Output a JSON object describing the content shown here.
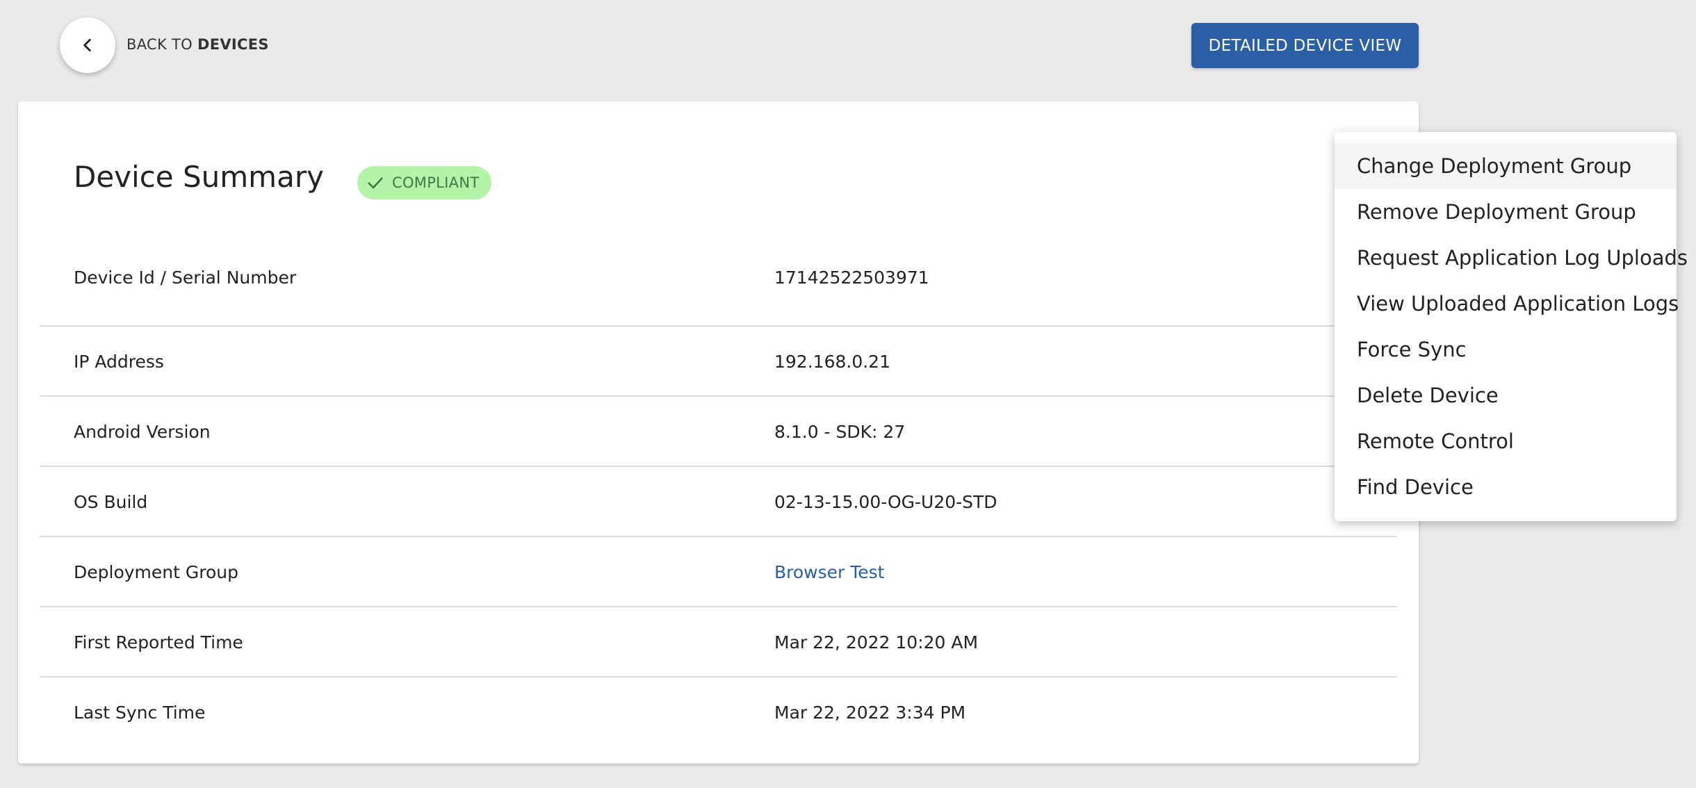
{
  "back": {
    "prefix": "BACK TO",
    "target": "DEVICES"
  },
  "header": {
    "detail_button_label": "DETAILED DEVICE VIEW"
  },
  "summary": {
    "title": "Device Summary",
    "status": "COMPLIANT",
    "status_color": "#b5f3a8",
    "rows": [
      {
        "label": "Device Id / Serial Number",
        "value": "17142522503971"
      },
      {
        "label": "IP Address",
        "value": "192.168.0.21"
      },
      {
        "label": "Android Version",
        "value": "8.1.0 - SDK: 27"
      },
      {
        "label": "OS Build",
        "value": "02-13-15.00-OG-U20-STD"
      },
      {
        "label": "Deployment Group",
        "value": "Browser Test"
      },
      {
        "label": "First Reported Time",
        "value": "Mar 22, 2022 10:20 AM"
      },
      {
        "label": "Last Sync Time",
        "value": "Mar 22, 2022 3:34 PM"
      }
    ]
  },
  "menu": {
    "items": [
      {
        "label": "Change Deployment Group"
      },
      {
        "label": "Remove Deployment Group"
      },
      {
        "label": "Request Application Log Uploads"
      },
      {
        "label": "View Uploaded Application Logs"
      },
      {
        "label": "Force Sync"
      },
      {
        "label": "Delete Device"
      },
      {
        "label": "Remote Control"
      },
      {
        "label": "Find Device"
      }
    ]
  },
  "colors": {
    "accent": "#2a5fa5",
    "background": "#ebebeb"
  },
  "icons": {
    "back": "chevron-left-icon",
    "status": "check-icon"
  }
}
